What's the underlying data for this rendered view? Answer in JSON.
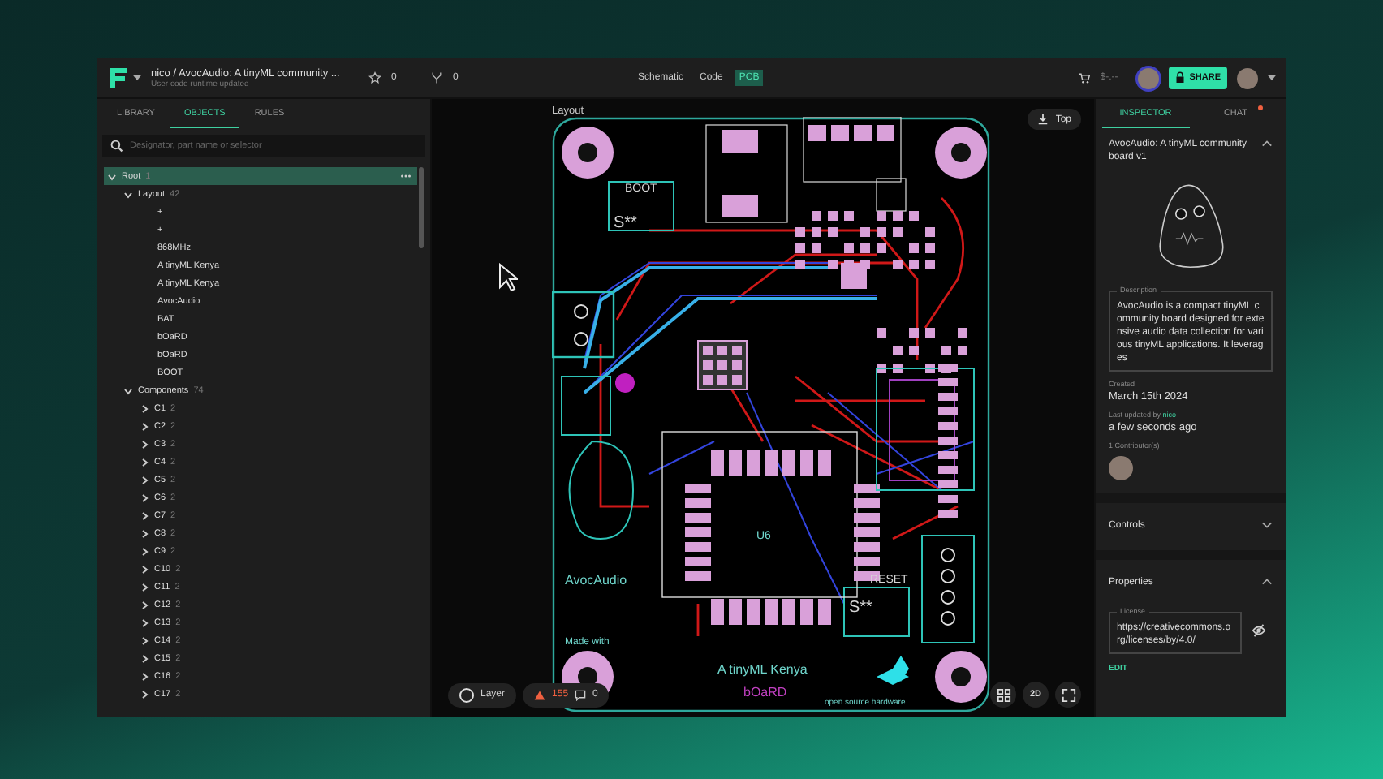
{
  "topbar": {
    "breadcrumb": "nico / AvocAudio: A tinyML community ...",
    "status": "User code runtime updated",
    "stars": "0",
    "forks": "0",
    "views": [
      {
        "label": "Schematic",
        "selected": false
      },
      {
        "label": "Code",
        "selected": false
      },
      {
        "label": "PCB",
        "selected": true
      }
    ],
    "price": "$-.--",
    "share": "SHARE"
  },
  "left": {
    "tabs": [
      {
        "label": "LIBRARY",
        "selected": false
      },
      {
        "label": "OBJECTS",
        "selected": true
      },
      {
        "label": "RULES",
        "selected": false
      }
    ],
    "search": {
      "placeholder": "Designator, part name or selector"
    },
    "tree": [
      {
        "label": "Root",
        "count": "1",
        "expanded": true,
        "selected": true,
        "children": [
          {
            "label": "Layout",
            "count": "42",
            "expanded": true,
            "selected": false,
            "children": [
              {
                "label": "+",
                "selected": false
              },
              {
                "label": "+",
                "selected": false
              },
              {
                "label": "868MHz",
                "selected": false
              },
              {
                "label": "A tinyML Kenya",
                "selected": false
              },
              {
                "label": "A tinyML Kenya",
                "selected": false
              },
              {
                "label": "AvocAudio",
                "selected": false
              },
              {
                "label": "BAT",
                "selected": false
              },
              {
                "label": "bOaRD",
                "selected": false
              },
              {
                "label": "bOaRD",
                "selected": false
              },
              {
                "label": "BOOT",
                "selected": false
              }
            ]
          },
          {
            "label": "Components",
            "count": "74",
            "expanded": true,
            "selected": false,
            "children": [
              {
                "label": "C1",
                "count": "2",
                "expanded": false,
                "selected": false
              },
              {
                "label": "C2",
                "count": "2",
                "expanded": false,
                "selected": false
              },
              {
                "label": "C3",
                "count": "2",
                "expanded": false,
                "selected": false
              },
              {
                "label": "C4",
                "count": "2",
                "expanded": false,
                "selected": false
              },
              {
                "label": "C5",
                "count": "2",
                "expanded": false,
                "selected": false
              },
              {
                "label": "C6",
                "count": "2",
                "expanded": false,
                "selected": false
              },
              {
                "label": "C7",
                "count": "2",
                "expanded": false,
                "selected": false
              },
              {
                "label": "C8",
                "count": "2",
                "expanded": false,
                "selected": false
              },
              {
                "label": "C9",
                "count": "2",
                "expanded": false,
                "selected": false
              },
              {
                "label": "C10",
                "count": "2",
                "expanded": false,
                "selected": false
              },
              {
                "label": "C11",
                "count": "2",
                "expanded": false,
                "selected": false
              },
              {
                "label": "C12",
                "count": "2",
                "expanded": false,
                "selected": false
              },
              {
                "label": "C13",
                "count": "2",
                "expanded": false,
                "selected": false
              },
              {
                "label": "C14",
                "count": "2",
                "expanded": false,
                "selected": false
              },
              {
                "label": "C15",
                "count": "2",
                "expanded": false,
                "selected": false
              },
              {
                "label": "C16",
                "count": "2",
                "expanded": false,
                "selected": false
              },
              {
                "label": "C17",
                "count": "2",
                "expanded": false,
                "selected": false
              }
            ]
          }
        ]
      }
    ]
  },
  "canvas": {
    "title": "Layout",
    "side_button": "Top",
    "pcb_labels": [
      "BOOT",
      "S**",
      "RESET",
      "S**",
      "U6",
      "AvocAudio",
      "Made with",
      "A tinyML Kenya",
      "bOaRD",
      "open source hardware"
    ],
    "layer_button": "Layer",
    "warnings": "155",
    "comments": "0",
    "view_button": "2D"
  },
  "inspector": {
    "tabs": [
      {
        "label": "INSPECTOR",
        "selected": true
      },
      {
        "label": "CHAT",
        "selected": false,
        "unread": true
      }
    ],
    "title": "AvocAudio: A tinyML community board v1",
    "description_label": "Description",
    "description": "AvocAudio is a compact tinyML community board designed for extensive audio data collection for various tinyML applications. It leverages",
    "created_label": "Created",
    "created": "March 15th 2024",
    "updated_label": "Last updated by",
    "updated_by": "nico",
    "updated": "a few seconds ago",
    "contributors_label": "1 Contributor(s)",
    "sections": [
      {
        "label": "Controls",
        "expanded": false
      },
      {
        "label": "Properties",
        "expanded": true
      }
    ],
    "license_label": "License",
    "license": "https://creativecommons.org/licenses/by/4.0/",
    "edit": "EDIT"
  }
}
